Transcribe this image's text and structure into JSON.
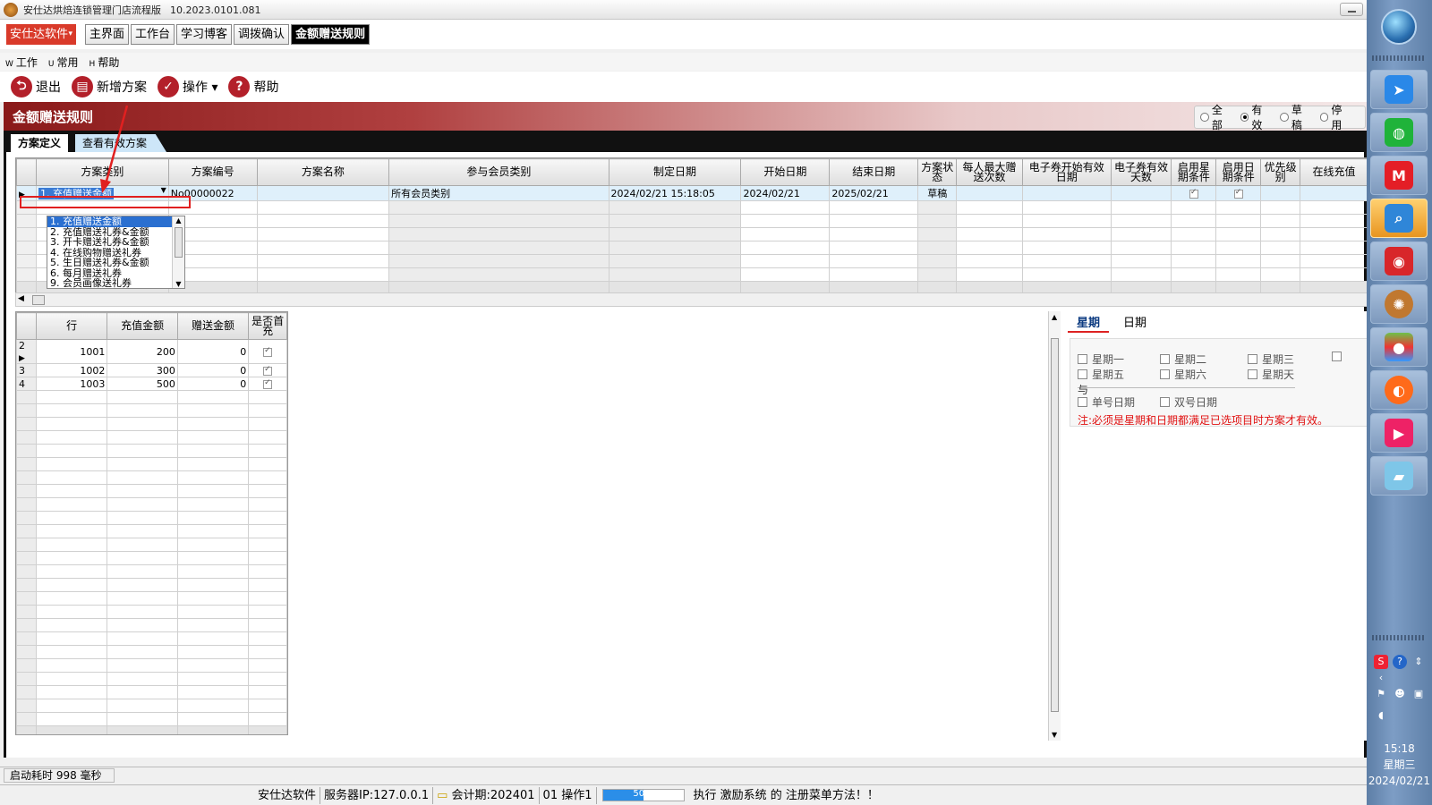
{
  "window": {
    "title": "安仕达烘焙连锁管理门店流程版",
    "version": "10.2023.0101.081"
  },
  "brand": "安仕达软件",
  "tabs": [
    "主界面",
    "工作台",
    "学习博客",
    "调拨确认",
    "金额赠送规则"
  ],
  "menu": [
    {
      "hk": "W",
      "label": "工作"
    },
    {
      "hk": "U",
      "label": "常用"
    },
    {
      "hk": "H",
      "label": "帮助"
    }
  ],
  "toolbar": [
    {
      "label": "退出",
      "icon": "exit-icon",
      "glyph": "⮌"
    },
    {
      "label": "新增方案",
      "icon": "new-doc-icon",
      "glyph": "▤"
    },
    {
      "label": "操作 ▾",
      "icon": "check-icon",
      "glyph": "✓"
    },
    {
      "label": "帮助",
      "icon": "help-icon",
      "glyph": "?"
    }
  ],
  "band_title": "金额赠送规则",
  "filter": {
    "options": [
      "全部",
      "有效",
      "草稿",
      "停用"
    ],
    "selected": "有效"
  },
  "subtabs": [
    "方案定义",
    "查看有效方案"
  ],
  "upper_grid": {
    "headers": [
      "方案类别",
      "方案编号",
      "方案名称",
      "参与会员类别",
      "制定日期",
      "开始日期",
      "结束日期",
      "方案状态",
      "每人最大赠送次数",
      "电子券开始有效日期",
      "电子券有效天数",
      "启用星期条件",
      "启用日期条件",
      "优先级别",
      "在线充值"
    ],
    "row": {
      "category": "1. 充值赠送金额",
      "code": "No00000022",
      "name": "",
      "member": "所有会员类别",
      "created": "2024/02/21 15:18:05",
      "start": "2024/02/21",
      "end": "2025/02/21",
      "status": "草稿",
      "week_enabled": true,
      "date_enabled": true
    }
  },
  "dropdown": {
    "options": [
      "1. 充值赠送金额",
      "2. 充值赠送礼券&金额",
      "3. 开卡赠送礼券&金额",
      "4. 在线购物赠送礼券",
      "5. 生日赠送礼券&金额",
      "6. 每月赠送礼券",
      "9. 会员画像送礼券"
    ],
    "highlighted": 0
  },
  "lower_grid": {
    "headers": [
      "行",
      "充值金额",
      "赠送金额",
      "是否首充"
    ],
    "rows": [
      {
        "idx": "2",
        "line": "1001",
        "amount": "200",
        "gift": "0",
        "first": true
      },
      {
        "idx": "3",
        "line": "1002",
        "amount": "300",
        "gift": "0",
        "first": true
      },
      {
        "idx": "4",
        "line": "1003",
        "amount": "500",
        "gift": "0",
        "first": true
      }
    ]
  },
  "conditions": {
    "tabs": [
      "星期",
      "日期"
    ],
    "weekdays": [
      "星期一",
      "星期二",
      "星期三",
      "星期五",
      "星期六",
      "星期天"
    ],
    "and_label": "与",
    "odd_even": [
      "单号日期",
      "双号日期"
    ],
    "note": "注:必须是星期和日期都满足已选项目时方案才有效。"
  },
  "status": {
    "startup": "启动耗时 998 毫秒",
    "company": "安仕达软件",
    "server": "服务器IP:127.0.0.1",
    "period": "会计期:202401",
    "operator": "01 操作1",
    "progress": 50,
    "progress_label": "50%",
    "message": "执行 激励系统 的 注册菜单方法！！"
  },
  "clock": {
    "time": "15:18",
    "weekday": "星期三",
    "date": "2024/02/21"
  },
  "colors": {
    "brand": "#d93a2a",
    "accent": "#b3202a",
    "selection": "#3a7bd5",
    "note": "#e01010"
  }
}
